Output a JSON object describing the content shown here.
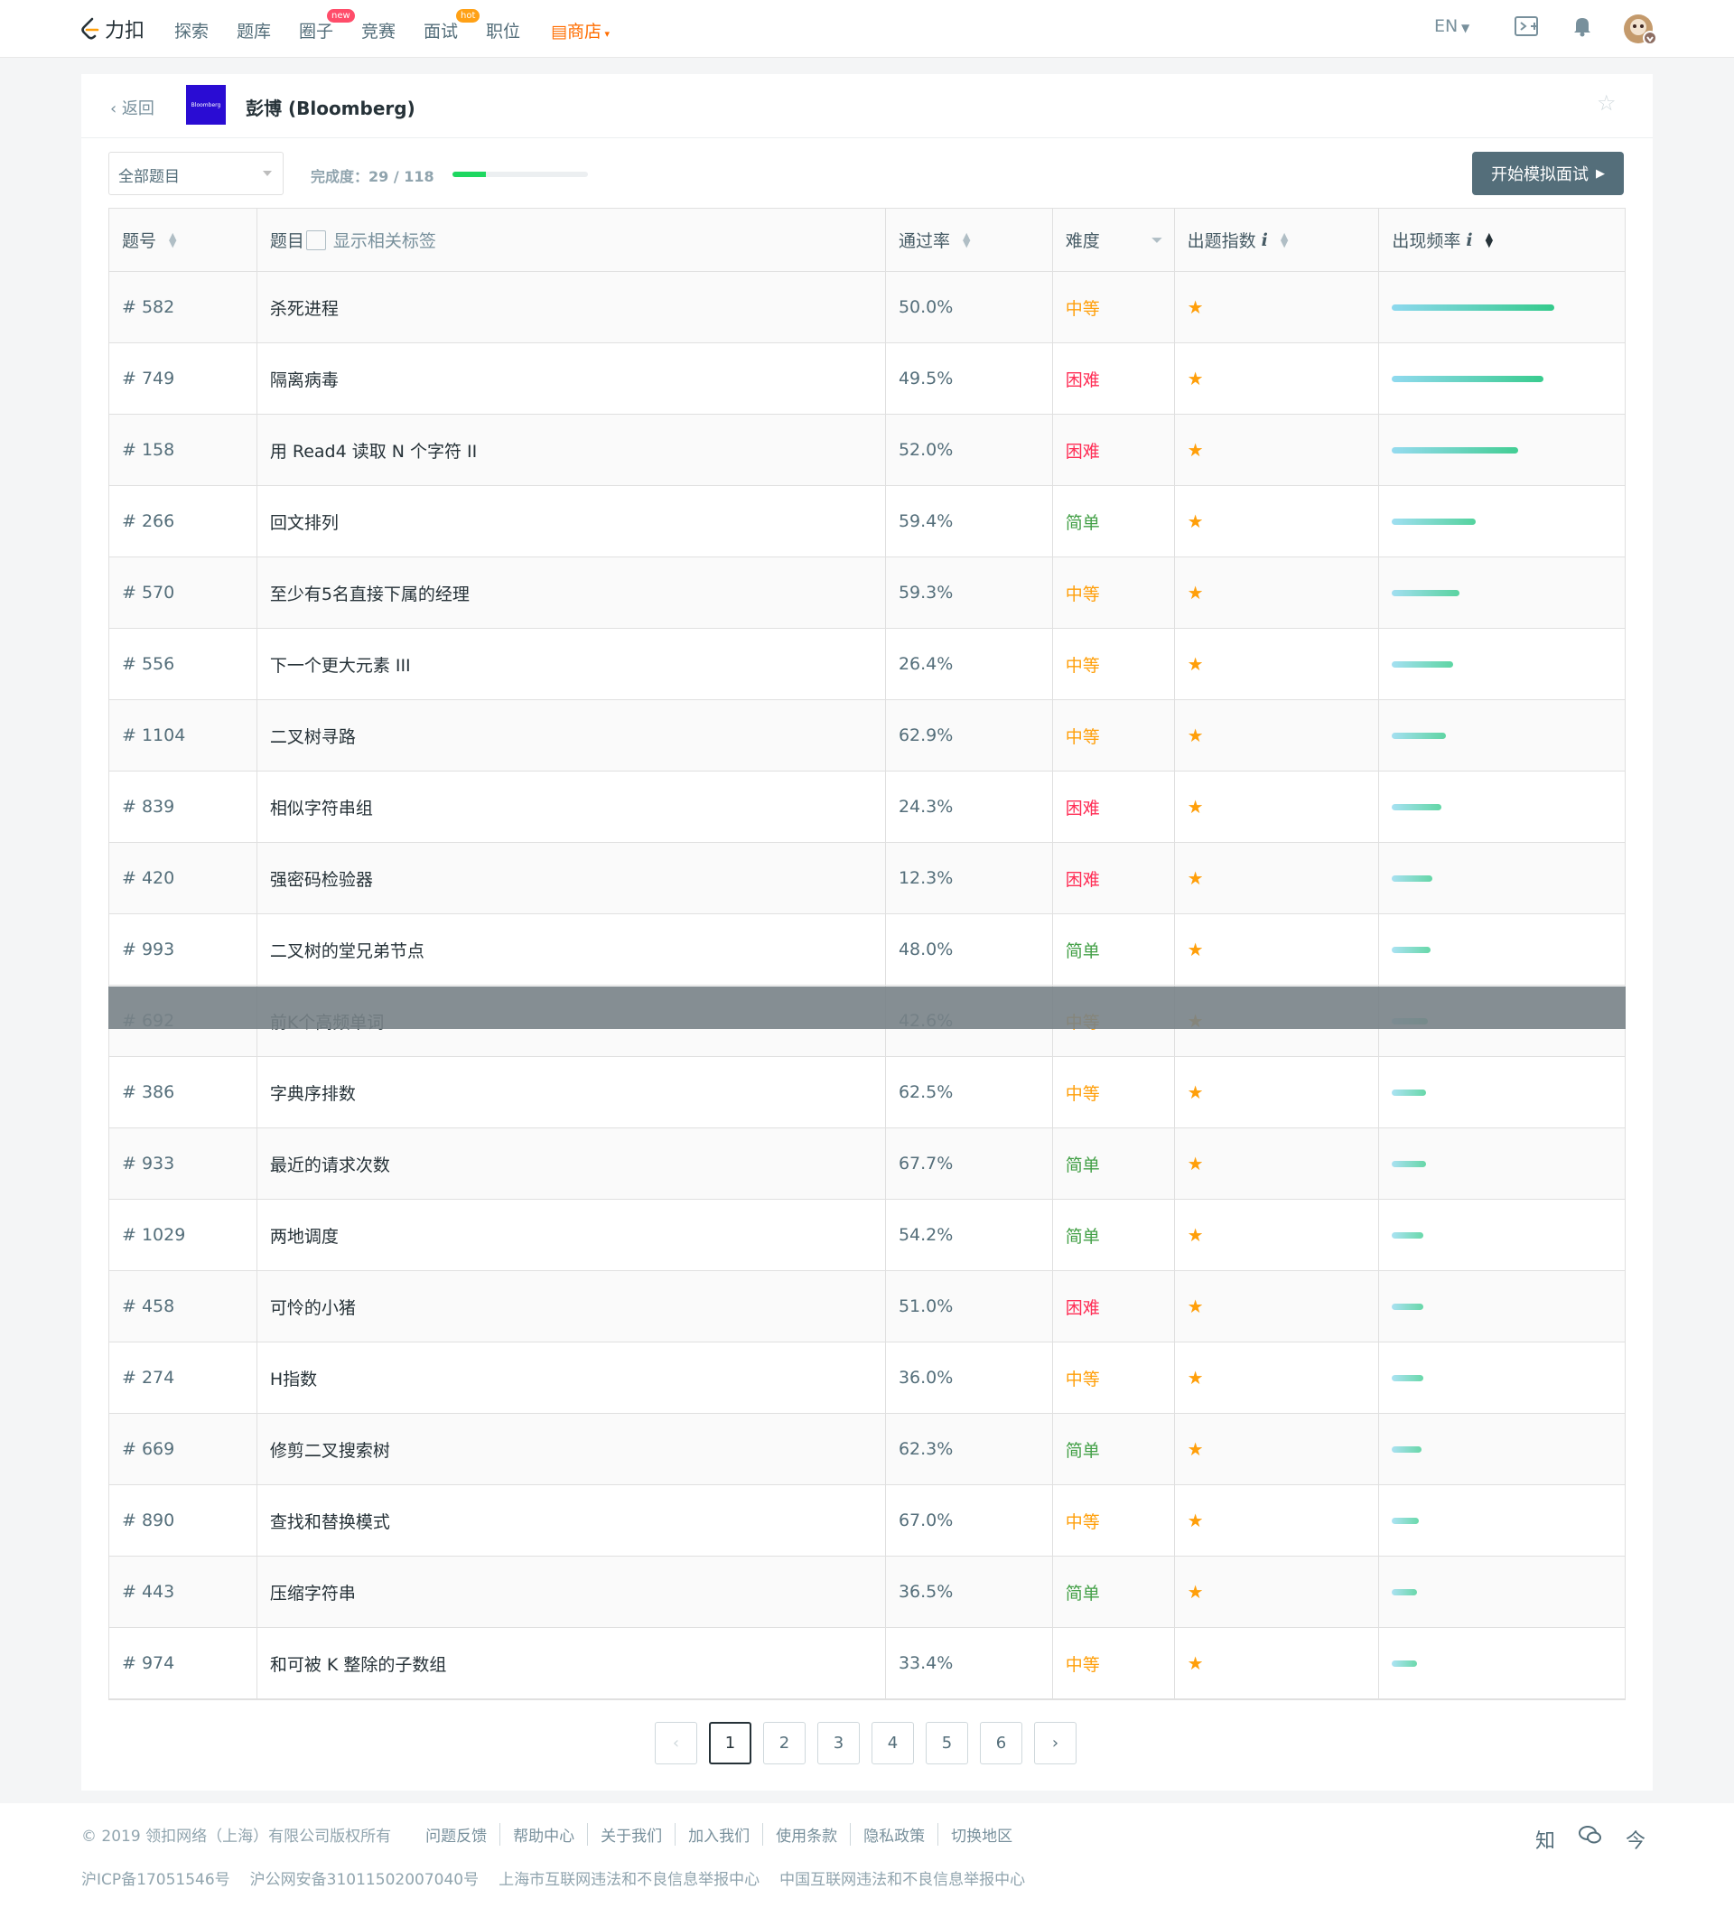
{
  "nav": {
    "logo_text": "力扣",
    "items": [
      "探索",
      "题库",
      "圈子",
      "竞赛",
      "面试",
      "职位",
      "商店"
    ],
    "badge_new": "new",
    "badge_hot": "hot",
    "lang": "EN",
    "accent": "#ff6d00"
  },
  "company": {
    "back_label": "返回",
    "logo_text": "Bloomberg",
    "name": "彭博 (Bloomberg)"
  },
  "toolbar": {
    "filter_value": "全部题目",
    "progress_label": "完成度：29 / 118",
    "progress_fraction": 0.2458,
    "mock_button": "开始模拟面试"
  },
  "table": {
    "headers": {
      "id": "题号",
      "title": "题目",
      "show_tags": "显示相关标签",
      "acceptance": "通过率",
      "difficulty": "难度",
      "index": "出题指数",
      "frequency": "出现频率",
      "info": "i"
    },
    "rows": [
      {
        "id": "# 582",
        "title": "杀死进程",
        "rate": "50.0%",
        "diff": "中等",
        "freq": 0.72
      },
      {
        "id": "# 749",
        "title": "隔离病毒",
        "rate": "49.5%",
        "diff": "困难",
        "freq": 0.67
      },
      {
        "id": "# 158",
        "title": "用 Read4 读取 N 个字符 II",
        "rate": "52.0%",
        "diff": "困难",
        "freq": 0.56
      },
      {
        "id": "# 266",
        "title": "回文排列",
        "rate": "59.4%",
        "diff": "简单",
        "freq": 0.37
      },
      {
        "id": "# 570",
        "title": "至少有5名直接下属的经理",
        "rate": "59.3%",
        "diff": "中等",
        "freq": 0.3
      },
      {
        "id": "# 556",
        "title": "下一个更大元素 III",
        "rate": "26.4%",
        "diff": "中等",
        "freq": 0.27
      },
      {
        "id": "# 1104",
        "title": "二叉树寻路",
        "rate": "62.9%",
        "diff": "中等",
        "freq": 0.24
      },
      {
        "id": "# 839",
        "title": "相似字符串组",
        "rate": "24.3%",
        "diff": "困难",
        "freq": 0.22
      },
      {
        "id": "# 420",
        "title": "强密码检验器",
        "rate": "12.3%",
        "diff": "困难",
        "freq": 0.18
      },
      {
        "id": "# 993",
        "title": "二叉树的堂兄弟节点",
        "rate": "48.0%",
        "diff": "简单",
        "freq": 0.17
      },
      {
        "id": "# 692",
        "title": "前K个高频单词",
        "rate": "42.6%",
        "diff": "中等",
        "freq": 0.16
      },
      {
        "id": "# 386",
        "title": "字典序排数",
        "rate": "62.5%",
        "diff": "中等",
        "freq": 0.15
      },
      {
        "id": "# 933",
        "title": "最近的请求次数",
        "rate": "67.7%",
        "diff": "简单",
        "freq": 0.15
      },
      {
        "id": "# 1029",
        "title": "两地调度",
        "rate": "54.2%",
        "diff": "简单",
        "freq": 0.14
      },
      {
        "id": "# 458",
        "title": "可怜的小猪",
        "rate": "51.0%",
        "diff": "困难",
        "freq": 0.14
      },
      {
        "id": "# 274",
        "title": "H指数",
        "rate": "36.0%",
        "diff": "中等",
        "freq": 0.14
      },
      {
        "id": "# 669",
        "title": "修剪二叉搜索树",
        "rate": "62.3%",
        "diff": "简单",
        "freq": 0.13
      },
      {
        "id": "# 890",
        "title": "查找和替换模式",
        "rate": "67.0%",
        "diff": "中等",
        "freq": 0.12
      },
      {
        "id": "# 443",
        "title": "压缩字符串",
        "rate": "36.5%",
        "diff": "简单",
        "freq": 0.11
      },
      {
        "id": "# 974",
        "title": "和可被 K 整除的子数组",
        "rate": "33.4%",
        "diff": "中等",
        "freq": 0.11
      }
    ]
  },
  "pagination": {
    "pages": [
      "1",
      "2",
      "3",
      "4",
      "5",
      "6"
    ],
    "current": "1"
  },
  "footer": {
    "copyright": "© 2019 领扣网络（上海）有限公司版权所有",
    "links": [
      "问题反馈",
      "帮助中心",
      "关于我们",
      "加入我们",
      "使用条款",
      "隐私政策",
      "切换地区"
    ],
    "legal": [
      "沪ICP备17051546号",
      "沪公网安备31011502007040号",
      "上海市互联网违法和不良信息举报中心",
      "中国互联网违法和不良信息举报中心"
    ],
    "social": [
      "知",
      "微",
      "今"
    ]
  }
}
